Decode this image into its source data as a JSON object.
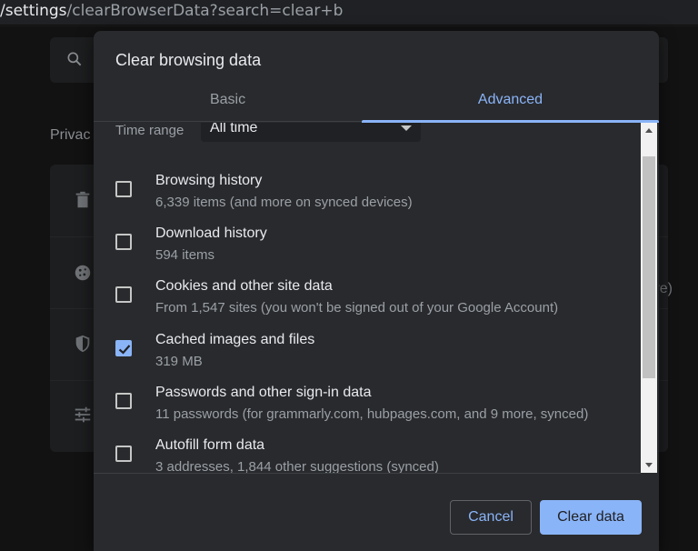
{
  "url": {
    "prefix": "/settings",
    "path": "/clearBrowserData?search=clear+b"
  },
  "background": {
    "section_label": "Privac",
    "trailing_text": "re)"
  },
  "dialog": {
    "title": "Clear browsing data",
    "tabs": [
      {
        "label": "Basic",
        "selected": false
      },
      {
        "label": "Advanced",
        "selected": true
      }
    ],
    "time_range": {
      "label": "Time range",
      "value": "All time"
    },
    "items": [
      {
        "title": "Browsing history",
        "description": "6,339 items (and more on synced devices)",
        "checked": false
      },
      {
        "title": "Download history",
        "description": "594 items",
        "checked": false
      },
      {
        "title": "Cookies and other site data",
        "description": "From 1,547 sites (you won't be signed out of your Google Account)",
        "checked": false
      },
      {
        "title": "Cached images and files",
        "description": "319 MB",
        "checked": true
      },
      {
        "title": "Passwords and other sign-in data",
        "description": "11 passwords (for grammarly.com, hubpages.com, and 9 more, synced)",
        "checked": false
      },
      {
        "title": "Autofill form data",
        "description": "3 addresses, 1,844 other suggestions (synced)",
        "checked": false
      }
    ],
    "buttons": {
      "cancel": "Cancel",
      "clear": "Clear data"
    }
  },
  "colors": {
    "accent": "#8ab4f8",
    "dialog_bg": "#292a2d",
    "page_bg": "#121213"
  },
  "icons": [
    "search-icon",
    "trash-icon",
    "cookie-icon",
    "shield-icon",
    "tune-icon",
    "chevron-down-icon",
    "checkmark-icon"
  ]
}
